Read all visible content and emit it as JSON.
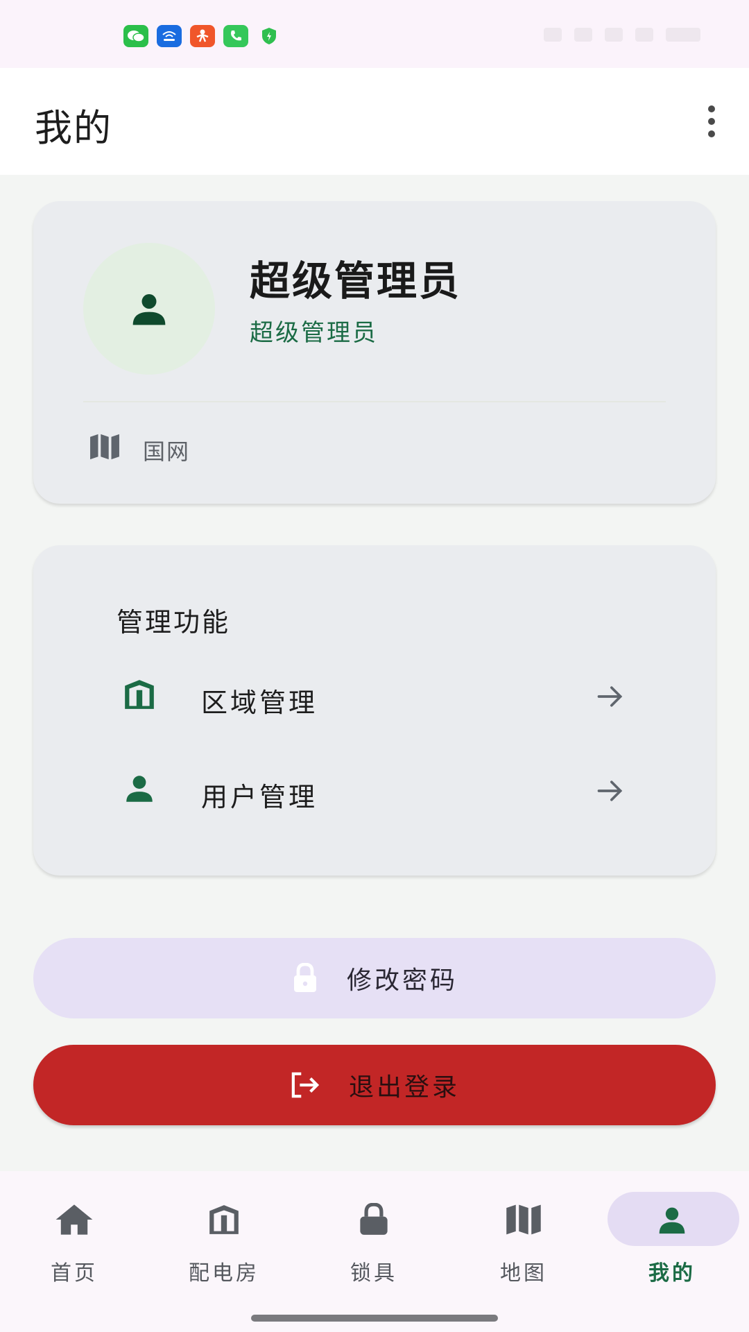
{
  "status_bar": {
    "notification_icons": [
      "wechat-icon",
      "wifi-app-icon",
      "social-app-icon",
      "phone-icon",
      "shield-icon"
    ]
  },
  "app_bar": {
    "title": "我的",
    "menu_icon": "more-vertical-icon"
  },
  "profile": {
    "name": "超级管理员",
    "role": "超级管理员",
    "organization": "国网",
    "avatar_icon": "person-icon",
    "organization_icon": "map-icon"
  },
  "management": {
    "title": "管理功能",
    "items": [
      {
        "label": "区域管理",
        "icon": "building-icon"
      },
      {
        "label": "用户管理",
        "icon": "person-icon"
      }
    ]
  },
  "actions": {
    "change_password": "修改密码",
    "logout": "退出登录"
  },
  "bottom_nav": {
    "items": [
      {
        "label": "首页",
        "icon": "home-icon"
      },
      {
        "label": "配电房",
        "icon": "building-icon"
      },
      {
        "label": "锁具",
        "icon": "lock-icon"
      },
      {
        "label": "地图",
        "icon": "map-icon"
      },
      {
        "label": "我的",
        "icon": "person-icon"
      }
    ],
    "active": "我的"
  },
  "colors": {
    "primary_green": "#1b6b45",
    "logout_red": "#c22626",
    "password_button": "#e6e0f5",
    "card_bg": "#eaecef"
  }
}
